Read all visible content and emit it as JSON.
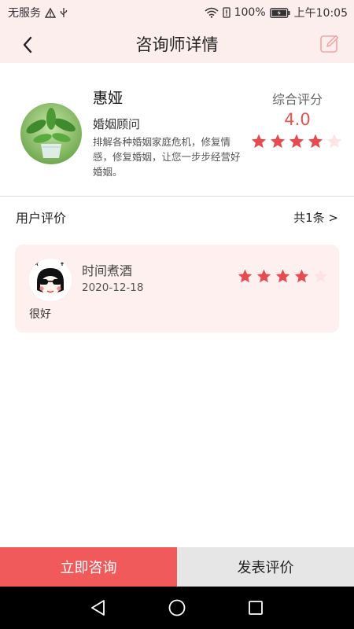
{
  "status_bar": {
    "carrier": "无服务",
    "battery": "100%",
    "time": "上午10:05"
  },
  "header": {
    "title": "咨询师详情",
    "back_icon": "chevron-left-icon",
    "edit_icon": "edit-icon"
  },
  "counselor": {
    "name": "惠娅",
    "role": "婚姻顾问",
    "description": "排解各种婚姻家庭危机，修复情感，修复婚姻，让您一步步经营好婚姻。",
    "rating_label": "综合评分",
    "rating": "4.0",
    "stars_filled": 4,
    "stars_total": 5
  },
  "reviews": {
    "title": "用户评价",
    "count": "共1条 >",
    "items": [
      {
        "user": "时间煮酒",
        "date": "2020-12-18",
        "text": "很好",
        "stars_filled": 4,
        "stars_total": 5
      }
    ]
  },
  "bottom": {
    "consult_label": "立即咨询",
    "review_label": "发表评价"
  },
  "colors": {
    "accent": "#f05a5a",
    "score": "#e8534d",
    "star_on": "#e84b4f",
    "star_off": "#fde3e3",
    "header_bg": "#fdeeee",
    "card_bg": "#fdf0ee"
  }
}
